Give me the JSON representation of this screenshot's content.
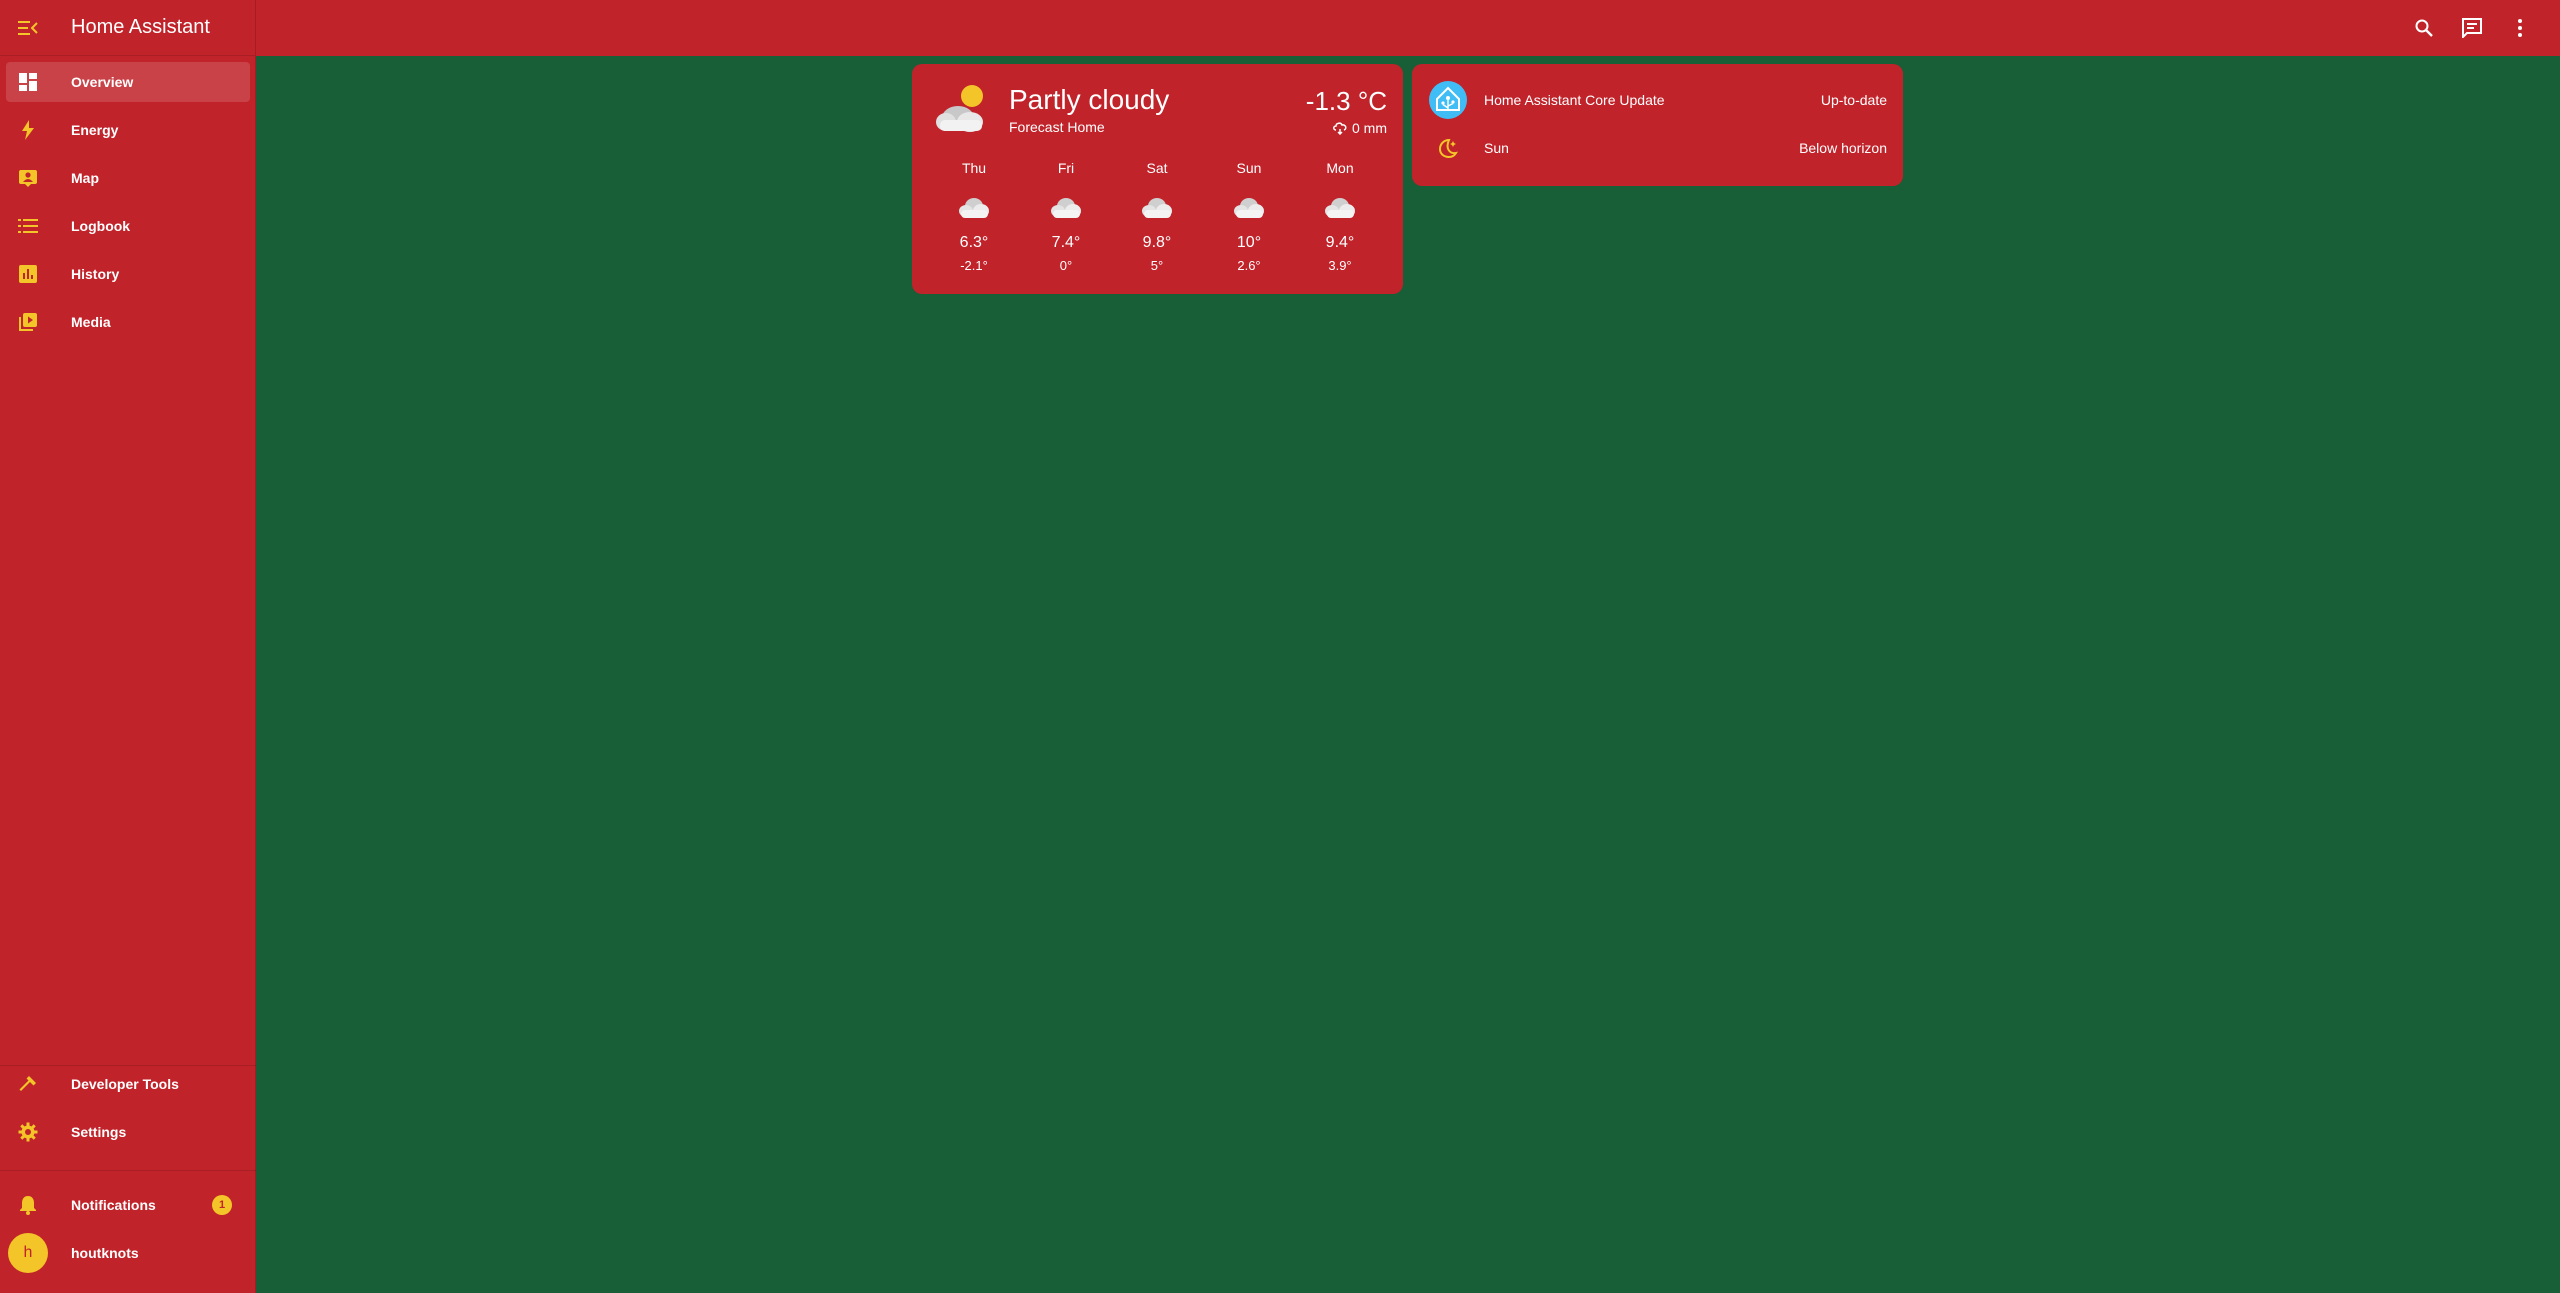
{
  "app": {
    "title": "Home Assistant"
  },
  "sidebar": {
    "items": [
      {
        "label": "Overview",
        "icon": "dashboard-icon",
        "active": true
      },
      {
        "label": "Energy",
        "icon": "lightning-bolt-icon"
      },
      {
        "label": "Map",
        "icon": "map-account-icon"
      },
      {
        "label": "Logbook",
        "icon": "list-icon"
      },
      {
        "label": "History",
        "icon": "chart-box-icon"
      },
      {
        "label": "Media",
        "icon": "play-box-multiple-icon"
      }
    ],
    "bottom_items": [
      {
        "label": "Developer Tools",
        "icon": "hammer-icon"
      },
      {
        "label": "Settings",
        "icon": "cog-icon"
      }
    ],
    "notifications": {
      "label": "Notifications",
      "count": "1"
    },
    "user": {
      "name": "houtknots",
      "initial": "h"
    }
  },
  "topbar": {
    "actions": [
      "search-icon",
      "assist-chat-icon",
      "more-vertical-icon"
    ]
  },
  "weather": {
    "state": "Partly cloudy",
    "name": "Forecast Home",
    "temperature": "-1.3 °C",
    "precipitation": "0 mm",
    "forecast": [
      {
        "day": "Thu",
        "high": "6.3°",
        "low": "-2.1°"
      },
      {
        "day": "Fri",
        "high": "7.4°",
        "low": "0°"
      },
      {
        "day": "Sat",
        "high": "9.8°",
        "low": "5°"
      },
      {
        "day": "Sun",
        "high": "10°",
        "low": "2.6°"
      },
      {
        "day": "Mon",
        "high": "9.4°",
        "low": "3.9°"
      }
    ]
  },
  "entities": [
    {
      "name": "Home Assistant Core Update",
      "value": "Up-to-date",
      "icon": "home-assistant-logo-icon"
    },
    {
      "name": "Sun",
      "value": "Below horizon",
      "icon": "weather-night-icon"
    }
  ],
  "colors": {
    "primary": "#c0232a",
    "background": "#185e36",
    "accent": "#f4c528"
  }
}
